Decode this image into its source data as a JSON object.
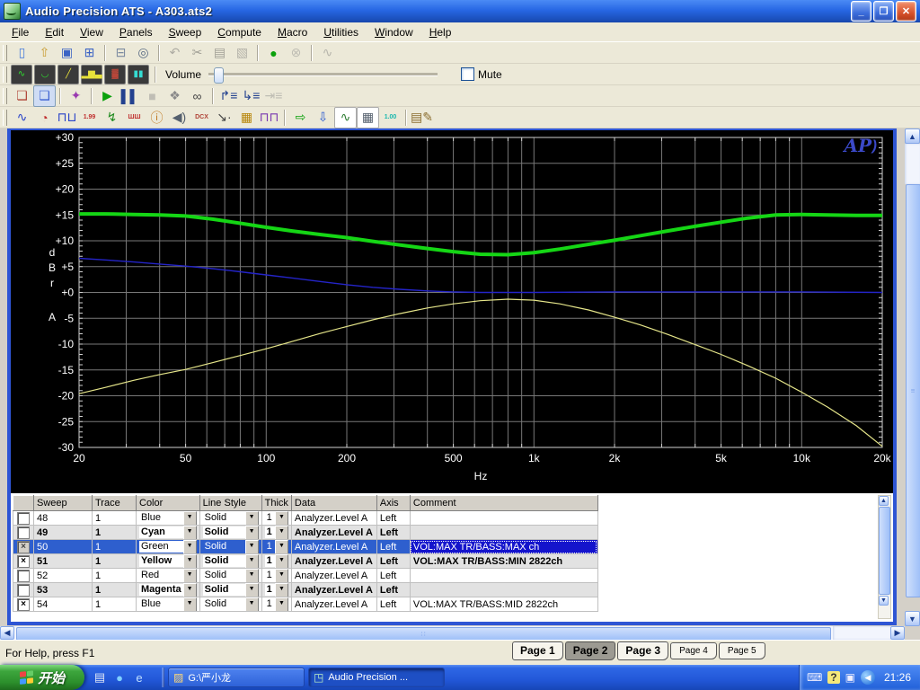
{
  "window": {
    "title": "Audio Precision ATS - A303.ats2",
    "controls": {
      "minimize": "_",
      "restore": "❐",
      "close": "✕"
    }
  },
  "menu": {
    "items": [
      {
        "label": "File"
      },
      {
        "label": "Edit"
      },
      {
        "label": "View"
      },
      {
        "label": "Panels"
      },
      {
        "label": "Sweep"
      },
      {
        "label": "Compute"
      },
      {
        "label": "Macro"
      },
      {
        "label": "Utilities"
      },
      {
        "label": "Window"
      },
      {
        "label": "Help"
      }
    ]
  },
  "toolbar1": {
    "icons": [
      {
        "name": "new-file-icon",
        "glyph": "▯",
        "color": "#4a7edb"
      },
      {
        "name": "open-file-icon",
        "glyph": "⇧",
        "color": "#c79b2e"
      },
      {
        "name": "save-icon",
        "glyph": "▣",
        "color": "#3b63c4"
      },
      {
        "name": "save-all-icon",
        "glyph": "⊞",
        "color": "#3b63c4"
      },
      {
        "sep": true
      },
      {
        "name": "print-icon",
        "glyph": "⊟",
        "color": "#7b8aa0"
      },
      {
        "name": "print-preview-icon",
        "glyph": "◎",
        "color": "#5a6c85"
      },
      {
        "sep": true
      },
      {
        "name": "undo-icon",
        "glyph": "↶",
        "color": "#3b63c4",
        "disabled": true
      },
      {
        "name": "cut-icon",
        "glyph": "✂",
        "color": "#444",
        "disabled": true
      },
      {
        "name": "copy-icon",
        "glyph": "▤",
        "color": "#444",
        "disabled": true
      },
      {
        "name": "paste-icon",
        "glyph": "▧",
        "color": "#8a6d2f",
        "disabled": true
      },
      {
        "sep": true
      },
      {
        "name": "monitors-on-icon",
        "glyph": "●",
        "color": "#0ca10c"
      },
      {
        "name": "monitors-off-icon",
        "glyph": "⊗",
        "color": "#888",
        "disabled": true
      },
      {
        "sep": true
      },
      {
        "name": "regulation-icon",
        "glyph": "∿",
        "color": "#777",
        "disabled": true
      }
    ]
  },
  "toolbar2": {
    "volume_label": "Volume",
    "mute_label": "Mute",
    "panels": [
      {
        "name": "panel-response-icon",
        "glyph": "∿",
        "color": "#2ee22e"
      },
      {
        "name": "panel-dip-icon",
        "glyph": "◡",
        "color": "#2ee22e"
      },
      {
        "name": "panel-sweep-icon",
        "glyph": "╱",
        "color": "#e8e23a"
      },
      {
        "name": "panel-bars-icon",
        "glyph": "▂▆▃",
        "color": "#e8e23a"
      },
      {
        "name": "panel-distortion-icon",
        "glyph": "▓",
        "color": "#d24a3a"
      },
      {
        "name": "panel-bargraph-icon",
        "glyph": "▮▮",
        "color": "#35dcd2"
      }
    ]
  },
  "toolbar3": {
    "icons": [
      {
        "name": "comment-off-icon",
        "glyph": "❏",
        "color": "#b04438"
      },
      {
        "name": "comment-on-icon",
        "glyph": "❏",
        "color": "#3a5fd0",
        "pressed": true
      },
      {
        "sep": true
      },
      {
        "name": "wizard-icon",
        "glyph": "✦",
        "color": "#9a3ab0"
      },
      {
        "sep": true
      },
      {
        "name": "sweep-go-icon",
        "glyph": "▶",
        "color": "#0ca10c"
      },
      {
        "name": "sweep-pause-icon",
        "glyph": "▌▌",
        "color": "#23418f"
      },
      {
        "name": "sweep-stop-icon",
        "glyph": "■",
        "color": "#8a8a8a",
        "disabled": true
      },
      {
        "name": "pan-hand-icon",
        "glyph": "❖",
        "color": "#8a8a8a"
      },
      {
        "name": "view-optimize-icon",
        "glyph": "∞",
        "color": "#444"
      },
      {
        "sep": true
      },
      {
        "name": "sweep-source1-icon",
        "glyph": "↱≡",
        "color": "#23418f"
      },
      {
        "name": "sweep-source2-icon",
        "glyph": "↳≡",
        "color": "#23418f"
      },
      {
        "name": "sweep-settling-icon",
        "glyph": "⇥≡",
        "color": "#888",
        "disabled": true
      }
    ]
  },
  "toolbar4": {
    "icons": [
      {
        "name": "scope-panel-icon",
        "glyph": "∿",
        "color": "#2a44c8"
      },
      {
        "name": "analog-meter-icon",
        "glyph": "◔",
        "color": "#c03030"
      },
      {
        "name": "square-wave-icon",
        "glyph": "⊓⊔",
        "color": "#2a44c8"
      },
      {
        "name": "digital-generator-icon",
        "glyph": "1.99",
        "color": "#c03030",
        "small": true
      },
      {
        "name": "jitter-icon",
        "glyph": "↯",
        "color": "#1e8a1e"
      },
      {
        "name": "bittest-icon",
        "glyph": "ШШ",
        "color": "#c03030",
        "small": true
      },
      {
        "name": "info-panel-icon",
        "glyph": "ⓘ",
        "color": "#c07820"
      },
      {
        "name": "speaker-icon",
        "glyph": "◀)",
        "color": "#55606e"
      },
      {
        "name": "dcx-panel-icon",
        "glyph": "DCX",
        "color": "#b04438",
        "small": true
      },
      {
        "name": "probe-icon",
        "glyph": "↘·",
        "color": "#444"
      },
      {
        "name": "switcher-icon",
        "glyph": "▦",
        "color": "#b8860b"
      },
      {
        "name": "dual-domain-icon",
        "glyph": "⊓⊓",
        "color": "#7a3ab0"
      },
      {
        "sep": true
      },
      {
        "name": "go-data-icon",
        "glyph": "⇨",
        "color": "#0ca10c"
      },
      {
        "name": "import-data-icon",
        "glyph": "⇩",
        "color": "#2a5ad0"
      },
      {
        "name": "graph-panel-icon",
        "glyph": "∿",
        "color": "#2e7d32",
        "light": true
      },
      {
        "name": "data-editor-icon",
        "glyph": "▦",
        "color": "#55606e",
        "light": true
      },
      {
        "name": "bar-meter-icon",
        "glyph": "1.00",
        "color": "#18b8ae",
        "small": true
      },
      {
        "sep": true
      },
      {
        "name": "macro-editor-icon",
        "glyph": "▤✎",
        "color": "#8a6d2f"
      }
    ]
  },
  "chart_data": {
    "type": "line",
    "xscale": "log",
    "xlabel": "Hz",
    "ylabel_stack": [
      "d",
      "B",
      "r",
      "A"
    ],
    "xlim": [
      20,
      20000
    ],
    "ylim": [
      -30,
      30
    ],
    "logo": "AP",
    "grid": true,
    "yticks": [
      {
        "v": 30,
        "label": "+30"
      },
      {
        "v": 25,
        "label": "+25"
      },
      {
        "v": 20,
        "label": "+20"
      },
      {
        "v": 15,
        "label": "+15"
      },
      {
        "v": 10,
        "label": "+10"
      },
      {
        "v": 5,
        "label": "+5"
      },
      {
        "v": 0,
        "label": "+0"
      },
      {
        "v": -5,
        "label": "-5"
      },
      {
        "v": -10,
        "label": "-10"
      },
      {
        "v": -15,
        "label": "-15"
      },
      {
        "v": -20,
        "label": "-20"
      },
      {
        "v": -25,
        "label": "-25"
      },
      {
        "v": -30,
        "label": "-30"
      }
    ],
    "xticks": [
      {
        "v": 20,
        "label": "20"
      },
      {
        "v": 50,
        "label": "50"
      },
      {
        "v": 100,
        "label": "100"
      },
      {
        "v": 200,
        "label": "200"
      },
      {
        "v": 500,
        "label": "500"
      },
      {
        "v": 1000,
        "label": "1k"
      },
      {
        "v": 2000,
        "label": "2k"
      },
      {
        "v": 5000,
        "label": "5k"
      },
      {
        "v": 10000,
        "label": "10k"
      },
      {
        "v": 20000,
        "label": "20k"
      }
    ],
    "series": [
      {
        "name": "VOL:MAX TR/BASS:MAX ch",
        "color": "#15d615",
        "width": 4,
        "points": [
          [
            20,
            15.2
          ],
          [
            25,
            15.2
          ],
          [
            32,
            15.1
          ],
          [
            40,
            15.0
          ],
          [
            50,
            14.8
          ],
          [
            63,
            14.2
          ],
          [
            80,
            13.4
          ],
          [
            100,
            12.6
          ],
          [
            125,
            11.9
          ],
          [
            160,
            11.2
          ],
          [
            200,
            10.6
          ],
          [
            250,
            9.9
          ],
          [
            315,
            9.2
          ],
          [
            400,
            8.5
          ],
          [
            500,
            7.9
          ],
          [
            630,
            7.4
          ],
          [
            800,
            7.3
          ],
          [
            1000,
            7.7
          ],
          [
            1250,
            8.4
          ],
          [
            1600,
            9.3
          ],
          [
            2000,
            10.1
          ],
          [
            2500,
            11.0
          ],
          [
            3150,
            11.9
          ],
          [
            4000,
            12.8
          ],
          [
            5000,
            13.6
          ],
          [
            6300,
            14.4
          ],
          [
            8000,
            15.0
          ],
          [
            10000,
            15.1
          ],
          [
            12500,
            15.0
          ],
          [
            16000,
            14.9
          ],
          [
            20000,
            14.9
          ]
        ]
      },
      {
        "name": "VOL:MAX TR/BASS:MID 2822ch",
        "color": "#2424c8",
        "width": 1.4,
        "points": [
          [
            20,
            6.6
          ],
          [
            25,
            6.3
          ],
          [
            32,
            5.9
          ],
          [
            40,
            5.5
          ],
          [
            50,
            5.1
          ],
          [
            63,
            4.6
          ],
          [
            80,
            4.0
          ],
          [
            100,
            3.4
          ],
          [
            125,
            2.8
          ],
          [
            160,
            2.1
          ],
          [
            200,
            1.5
          ],
          [
            250,
            1.0
          ],
          [
            315,
            0.6
          ],
          [
            400,
            0.3
          ],
          [
            500,
            0.1
          ],
          [
            630,
            0.0
          ],
          [
            800,
            0.0
          ],
          [
            1000,
            0.0
          ],
          [
            2000,
            0.1
          ],
          [
            5000,
            0.1
          ],
          [
            10000,
            0.1
          ],
          [
            20000,
            0.0
          ]
        ]
      },
      {
        "name": "VOL:MAX TR/BASS:MIN 2822ch",
        "color": "#e6e68a",
        "width": 1.2,
        "points": [
          [
            20,
            -19.6
          ],
          [
            25,
            -18.4
          ],
          [
            32,
            -17.0
          ],
          [
            40,
            -15.9
          ],
          [
            50,
            -14.9
          ],
          [
            63,
            -13.6
          ],
          [
            80,
            -12.2
          ],
          [
            100,
            -10.9
          ],
          [
            125,
            -9.5
          ],
          [
            160,
            -7.9
          ],
          [
            200,
            -6.6
          ],
          [
            250,
            -5.3
          ],
          [
            315,
            -4.1
          ],
          [
            400,
            -3.0
          ],
          [
            500,
            -2.2
          ],
          [
            630,
            -1.6
          ],
          [
            800,
            -1.3
          ],
          [
            1000,
            -1.5
          ],
          [
            1250,
            -2.2
          ],
          [
            1600,
            -3.4
          ],
          [
            2000,
            -4.8
          ],
          [
            2500,
            -6.3
          ],
          [
            3150,
            -8.1
          ],
          [
            4000,
            -10.1
          ],
          [
            5000,
            -12.0
          ],
          [
            6300,
            -14.2
          ],
          [
            8000,
            -16.6
          ],
          [
            10000,
            -19.3
          ],
          [
            12500,
            -22.2
          ],
          [
            16000,
            -25.8
          ],
          [
            20000,
            -29.8
          ]
        ]
      }
    ]
  },
  "table": {
    "headers": [
      "",
      "Sweep",
      "Trace",
      "Color",
      "Line Style",
      "Thick",
      "Data",
      "Axis",
      "Comment"
    ],
    "rows": [
      {
        "checked": false,
        "sweep": "48",
        "trace": "1",
        "color": "Blue",
        "line_style": "Solid",
        "thick": "1",
        "data": "Analyzer.Level A",
        "axis": "Left",
        "comment": "",
        "bold": false,
        "selected": false,
        "shaded": false
      },
      {
        "checked": false,
        "sweep": "49",
        "trace": "1",
        "color": "Cyan",
        "line_style": "Solid",
        "thick": "1",
        "data": "Analyzer.Level A",
        "axis": "Left",
        "comment": "",
        "bold": true,
        "selected": false,
        "shaded": true
      },
      {
        "checked": true,
        "sweep": "50",
        "trace": "1",
        "color": "Green",
        "line_style": "Solid",
        "thick": "1",
        "data": "Analyzer.Level A",
        "axis": "Left",
        "comment": "VOL:MAX TR/BASS:MAX ch",
        "bold": false,
        "selected": true,
        "shaded": false
      },
      {
        "checked": true,
        "sweep": "51",
        "trace": "1",
        "color": "Yellow",
        "line_style": "Solid",
        "thick": "1",
        "data": "Analyzer.Level A",
        "axis": "Left",
        "comment": "VOL:MAX TR/BASS:MIN 2822ch",
        "bold": true,
        "selected": false,
        "shaded": true
      },
      {
        "checked": false,
        "sweep": "52",
        "trace": "1",
        "color": "Red",
        "line_style": "Solid",
        "thick": "1",
        "data": "Analyzer.Level A",
        "axis": "Left",
        "comment": "",
        "bold": false,
        "selected": false,
        "shaded": false
      },
      {
        "checked": false,
        "sweep": "53",
        "trace": "1",
        "color": "Magenta",
        "line_style": "Solid",
        "thick": "1",
        "data": "Analyzer.Level A",
        "axis": "Left",
        "comment": "",
        "bold": true,
        "selected": false,
        "shaded": true
      },
      {
        "checked": true,
        "sweep": "54",
        "trace": "1",
        "color": "Blue",
        "line_style": "Solid",
        "thick": "1",
        "data": "Analyzer.Level A",
        "axis": "Left",
        "comment": "VOL:MAX TR/BASS:MID 2822ch",
        "bold": false,
        "selected": false,
        "shaded": false
      }
    ]
  },
  "statusbar": {
    "help": "For Help, press F1",
    "pages": [
      {
        "label": "Page 1",
        "active": false,
        "small": false
      },
      {
        "label": "Page 2",
        "active": true,
        "small": false
      },
      {
        "label": "Page 3",
        "active": false,
        "small": false
      },
      {
        "label": "Page 4",
        "active": false,
        "small": true
      },
      {
        "label": "Page 5",
        "active": false,
        "small": true
      }
    ]
  },
  "taskbar": {
    "start_label": "开始",
    "quicklaunch": [
      {
        "name": "quicklaunch-desktop-icon",
        "glyph": "▤",
        "color": "#dfe6f5"
      },
      {
        "name": "quicklaunch-messenger-icon",
        "glyph": "●",
        "color": "#7fd0ff"
      },
      {
        "name": "quicklaunch-ie-icon",
        "glyph": "e",
        "color": "#bfe0ff"
      }
    ],
    "tasks": [
      {
        "label": "G:\\严小龙",
        "icon": "folder",
        "active": false
      },
      {
        "label": "Audio Precision ...",
        "icon": "ap",
        "active": true
      }
    ],
    "tray_icons": [
      {
        "name": "tray-keyboard-icon",
        "glyph": "⌨"
      },
      {
        "name": "tray-help-icon",
        "glyph": "?"
      },
      {
        "name": "tray-restore-icon",
        "glyph": "▣"
      }
    ],
    "language_indicator": "◀",
    "clock": "21:26"
  }
}
